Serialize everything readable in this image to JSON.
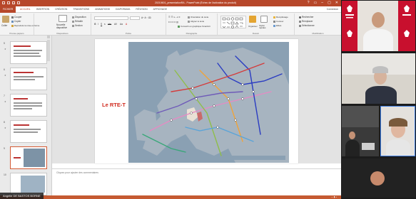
{
  "window": {
    "title": "20210601_presentationRA - PowerPoint (Échec de l'activation du produit)",
    "controls": [
      "?",
      "▭",
      "–",
      "▢",
      "✕"
    ]
  },
  "tabs": {
    "file": "FICHIER",
    "items": [
      "ACCUEIL",
      "INSERTION",
      "CRÉATION",
      "TRANSITIONS",
      "ANIMATIONS",
      "DIAPORAMA",
      "RÉVISION",
      "AFFICHAGE"
    ],
    "active": "ACCUEIL",
    "connection": "Connexion"
  },
  "ribbon": {
    "clipboard": {
      "label": "Presse-papiers",
      "paste": "Coller",
      "cut": "Couper",
      "copy": "Copier",
      "format": "Reproduire la mise en forme"
    },
    "slides": {
      "label": "Diapositives",
      "new": "Nouvelle diapositive",
      "layout": "Disposition",
      "reset": "Rétablir",
      "section": "Section"
    },
    "font": {
      "label": "Police"
    },
    "paragraph": {
      "label": "Paragraphe",
      "direction": "Orientation du texte",
      "align": "Aligner le texte",
      "smartart": "Convertir en graphique SmartArt"
    },
    "drawing": {
      "label": "Dessin",
      "arrange": "Organiser",
      "styles": "Styles rapides",
      "fill": "Remplissage",
      "outline": "Contour",
      "effects": "Effets"
    },
    "editing": {
      "label": "Modification",
      "find": "Rechercher",
      "replace": "Remplacer",
      "select": "Sélectionner"
    }
  },
  "thumbnails": [
    "5",
    "6",
    "7",
    "8",
    "9",
    "10"
  ],
  "selected_thumbnail": "9",
  "slide": {
    "title": "Le RTE-T"
  },
  "notes": {
    "placeholder": "Cliquez pour ajouter des commentaires"
  },
  "presenter": {
    "name": "Angelle DE BASTOS BORNE"
  },
  "colors": {
    "accent": "#b7472a",
    "title_red": "#d02a1e",
    "region_red": "#c8102e"
  }
}
